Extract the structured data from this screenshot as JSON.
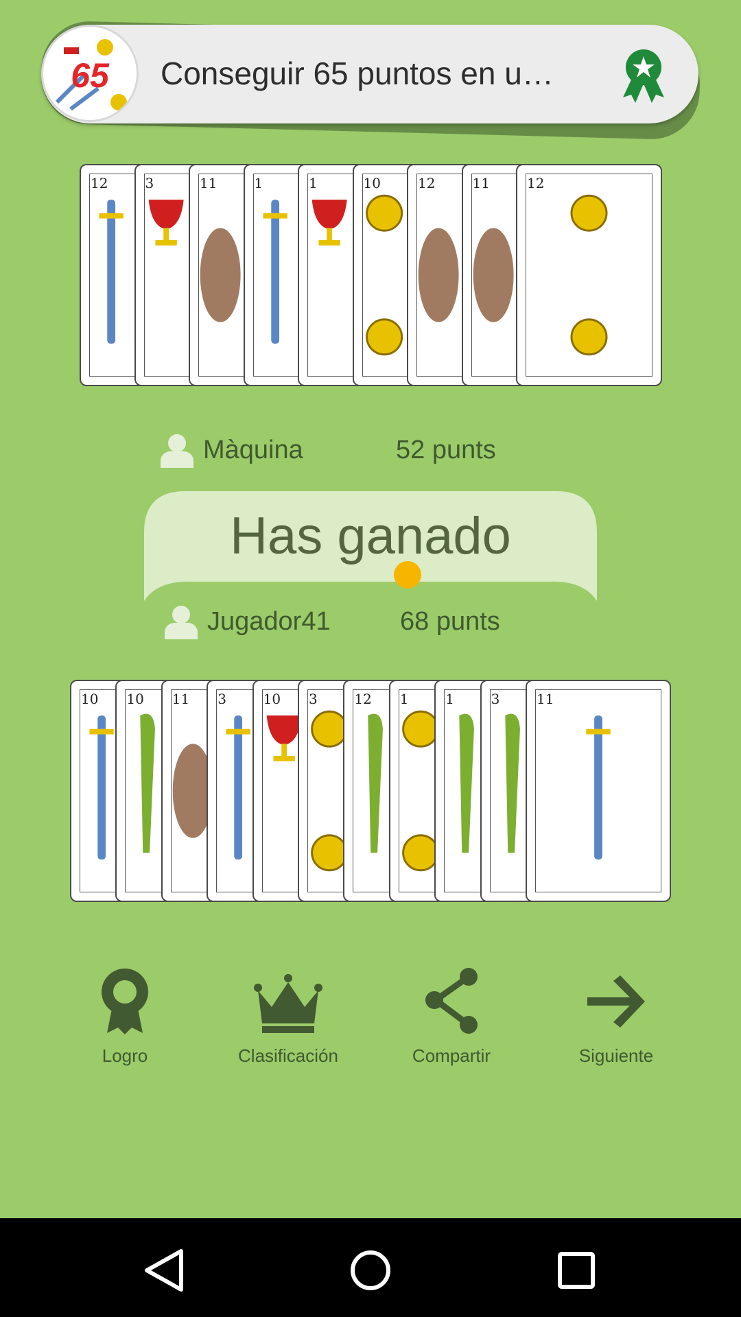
{
  "toast": {
    "text": "Conseguir 65 puntos en u…",
    "logo_number": "65",
    "award_icon": "award-ribbon-icon"
  },
  "opponent": {
    "name": "Màquina",
    "points": "52 punts",
    "cards": [
      {
        "rank": "12",
        "suit": "espadas"
      },
      {
        "rank": "3",
        "suit": "copas"
      },
      {
        "rank": "11",
        "suit": "unknown"
      },
      {
        "rank": "1",
        "suit": "espadas"
      },
      {
        "rank": "1",
        "suit": "copas"
      },
      {
        "rank": "10",
        "suit": "oros"
      },
      {
        "rank": "12",
        "suit": "unknown"
      },
      {
        "rank": "11",
        "suit": "unknown"
      },
      {
        "rank": "12",
        "suit": "oros"
      }
    ]
  },
  "result": {
    "title": "Has ganado"
  },
  "player": {
    "name": "Jugador41",
    "points": "68 punts",
    "cards": [
      {
        "rank": "10",
        "suit": "espadas"
      },
      {
        "rank": "10",
        "suit": "bastos"
      },
      {
        "rank": "11",
        "suit": "unknown"
      },
      {
        "rank": "3",
        "suit": "espadas"
      },
      {
        "rank": "10",
        "suit": "copas"
      },
      {
        "rank": "3",
        "suit": "oros"
      },
      {
        "rank": "12",
        "suit": "bastos"
      },
      {
        "rank": "1",
        "suit": "oros"
      },
      {
        "rank": "1",
        "suit": "bastos"
      },
      {
        "rank": "3",
        "suit": "bastos"
      },
      {
        "rank": "11",
        "suit": "espadas"
      }
    ]
  },
  "actions": [
    {
      "label": "Logro",
      "icon": "achievement-icon"
    },
    {
      "label": "Clasificación",
      "icon": "crown-icon"
    },
    {
      "label": "Compartir",
      "icon": "share-icon"
    },
    {
      "label": "Siguiente",
      "icon": "arrow-right-icon"
    }
  ],
  "colors": {
    "background": "#9ccb6a",
    "text": "#3f5a2f",
    "accent": "#f7b500",
    "espadas": "#5b86c4",
    "copas": "#d01f1f",
    "oros": "#e8c200",
    "bastos": "#7cae2f"
  }
}
